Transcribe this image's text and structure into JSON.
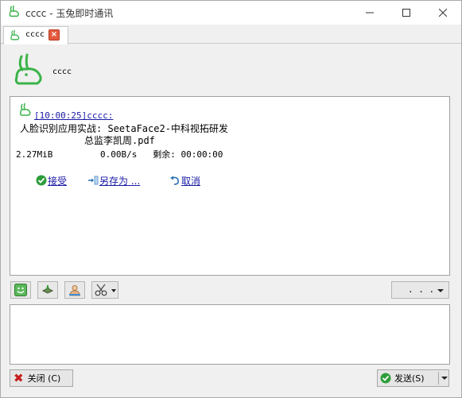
{
  "window": {
    "title": "cccc - 玉兔即时通讯",
    "icon": "rabbit-logo-icon",
    "controls": [
      "minimize-icon",
      "maximize-icon",
      "close-icon"
    ]
  },
  "tab": {
    "label": "cccc",
    "close_symbol": "×"
  },
  "contact": {
    "name": "cccc",
    "avatar_icon": "rabbit-avatar-icon"
  },
  "message": {
    "header": "[10:00:25]cccc:",
    "file_name_line1": "人脸识别应用实战: SeetaFace2-中科视拓研发",
    "file_name_line2": "总监李凯周.pdf",
    "file_size": "2.27MiB",
    "speed": "0.00B/s",
    "remaining": "剩余: 00:00:00",
    "actions": {
      "accept": "接受",
      "save_as": "另存为 ...",
      "cancel": "取消"
    }
  },
  "toolbar": {
    "emoji_icon": "smiley-icon",
    "shake_icon": "shake-window-icon",
    "image_icon": "image-icon",
    "screenshot_icon": "scissors-icon",
    "more_label": ". . ."
  },
  "buttons": {
    "close_label": "关闭 (C)",
    "send_label": "发送(S)"
  },
  "colors": {
    "link": "#1a1aa6",
    "brand_green": "#3bb34a",
    "close_red": "#c41d1d"
  }
}
